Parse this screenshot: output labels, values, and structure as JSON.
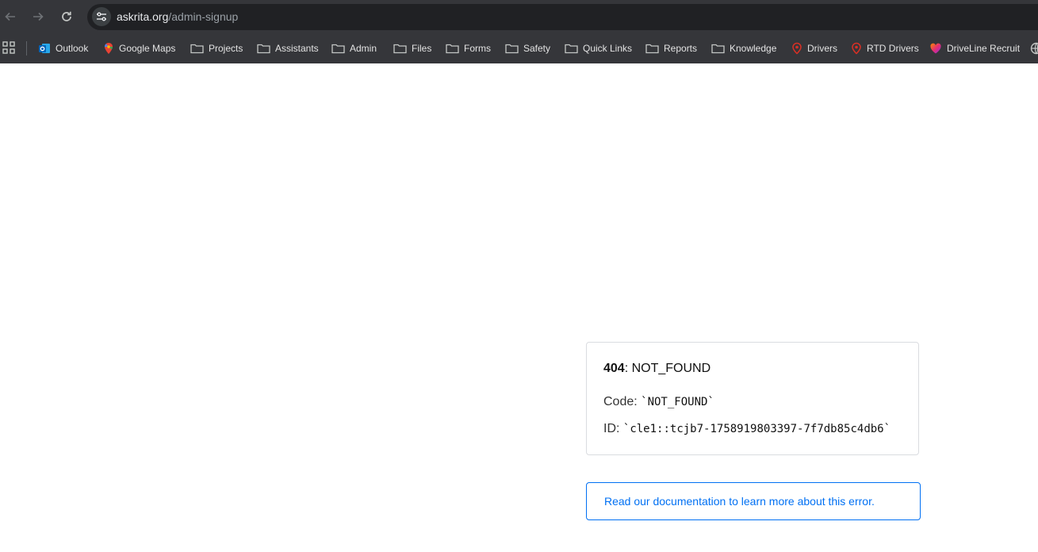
{
  "browser": {
    "url_host": "askrita.org",
    "url_path": "/admin-signup"
  },
  "bookmarks": [
    {
      "label": "Outlook",
      "icon": "outlook-icon"
    },
    {
      "label": "Google Maps",
      "icon": "google-maps-icon"
    },
    {
      "label": "Projects",
      "icon": "folder-icon"
    },
    {
      "label": "Assistants",
      "icon": "folder-icon"
    },
    {
      "label": "Admin",
      "icon": "folder-icon"
    },
    {
      "label": "Files",
      "icon": "folder-icon"
    },
    {
      "label": "Forms",
      "icon": "folder-icon"
    },
    {
      "label": "Safety",
      "icon": "folder-icon"
    },
    {
      "label": "Quick Links",
      "icon": "folder-icon"
    },
    {
      "label": "Reports",
      "icon": "folder-icon"
    },
    {
      "label": "Knowledge",
      "icon": "folder-icon"
    },
    {
      "label": "Drivers",
      "icon": "pin-icon"
    },
    {
      "label": "RTD Drivers",
      "icon": "pin-icon"
    },
    {
      "label": "DriveLine Recruit",
      "icon": "heart-logo-icon"
    }
  ],
  "error": {
    "status_code": "404",
    "status_text": ": NOT_FOUND",
    "code_label": "Code: ",
    "code_value": "`NOT_FOUND`",
    "id_label": "ID: ",
    "id_value": "`cle1::tcjb7-1758919803397-7f7db85c4db6`"
  },
  "doc_link": {
    "label": "Read our documentation to learn more about this error."
  },
  "colors": {
    "chrome_bg": "#35363a",
    "omnibox_bg": "#202124",
    "link_blue": "#0070f3",
    "card_border": "#dadce0"
  }
}
